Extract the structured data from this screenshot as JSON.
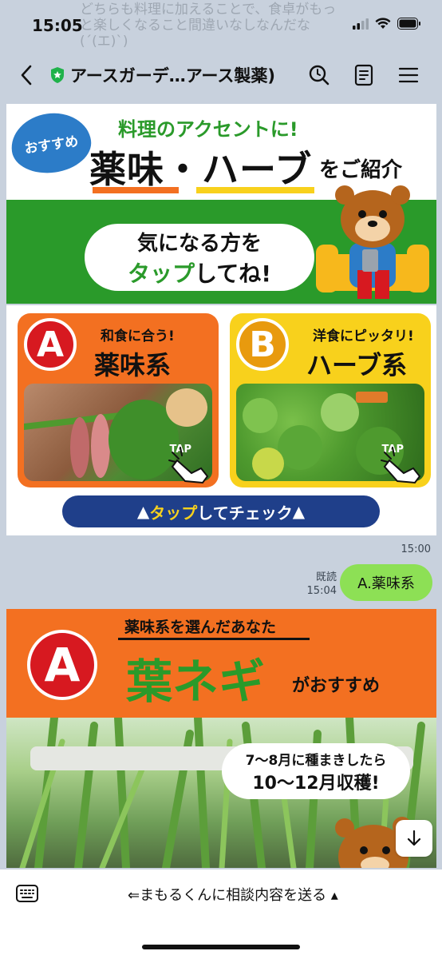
{
  "status_bar": {
    "time": "15:05"
  },
  "background_message": "どちらも料理に加えることで、食卓がもっと楽しくなること間違いなしなんだな(´(エ)`)",
  "header": {
    "title": "アースガーデ…アース製薬)"
  },
  "banner": {
    "badge": "おすすめ",
    "subtitle": "料理のアクセントに!",
    "main": "薬味・ハーブ",
    "tail": "をご紹介",
    "cloud_line1": "気になる方を",
    "cloud_line2_green": "タップ",
    "cloud_line2_rest": "してね!"
  },
  "cards": [
    {
      "letter": "A",
      "subtitle": "和食に合う!",
      "title": "薬味系",
      "tap": "TAP"
    },
    {
      "letter": "B",
      "subtitle": "洋食にピッタリ!",
      "title": "ハーブ系",
      "tap": "TAP"
    }
  ],
  "check_button": {
    "prefix": "▲",
    "highlight": "タップ",
    "rest": "してチェック",
    "suffix": "▲"
  },
  "messages": {
    "time_received": "15:00",
    "read_label": "既読",
    "sent_time": "15:04",
    "sent_text": "A.薬味系"
  },
  "recommendation": {
    "subtitle": "薬味系を選んだあなた",
    "letter": "A",
    "title": "葉ネギ",
    "tail": "がおすすめ",
    "callout_line1": "7〜8月に種まきしたら",
    "callout_line2": "10〜12月収穫!"
  },
  "bottom_bar": {
    "menu_text": "⇐まもるくんに相談内容を送る ▴"
  },
  "colors": {
    "green": "#2a9a2a",
    "orange": "#f37021",
    "yellow": "#f8d11c",
    "navy": "#1f3f8a",
    "bubble": "#8de055"
  }
}
